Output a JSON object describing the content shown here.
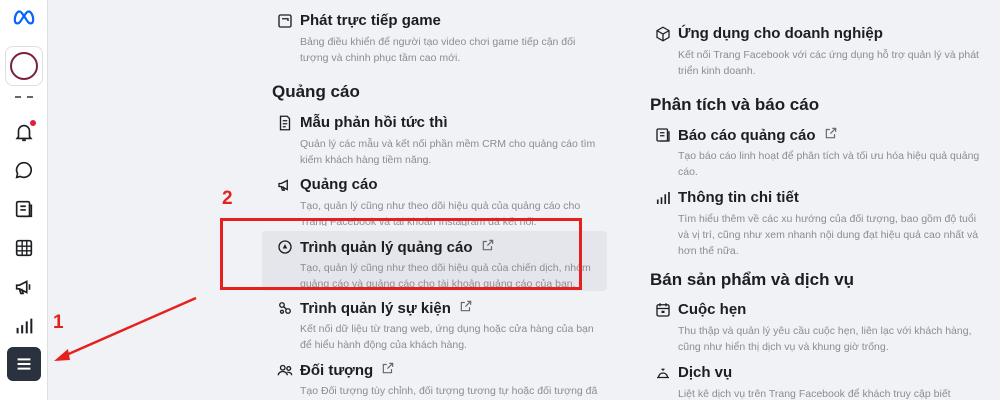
{
  "colors": {
    "accent": "#e5211f",
    "rail_active": "#29323e",
    "meta_blue": "#0866ff"
  },
  "sidebar": {
    "icons": [
      "meta-logo-icon",
      "bell-icon",
      "chat-bubble-icon",
      "pages-icon",
      "table-icon",
      "megaphone-icon",
      "bar-chart-icon",
      "hamburger-menu-icon"
    ]
  },
  "left_column": {
    "items_top": [
      {
        "title": "Phát trực tiếp game",
        "desc": "Bảng điều khiển để người tạo video chơi game tiếp cận đối tượng và chinh phục tầm cao mới."
      }
    ],
    "section_ads": "Quảng cáo",
    "ads_items": [
      {
        "title": "Mẫu phản hồi tức thì",
        "desc": "Quản lý các mẫu và kết nối phần mềm CRM cho quảng cáo tìm kiếm khách hàng tiềm năng."
      },
      {
        "title": "Quảng cáo",
        "desc": "Tạo, quản lý cũng như theo dõi hiệu quả của quảng cáo cho Trang Facebook và tài khoản Instagram đã kết nối."
      },
      {
        "title": "Trình quản lý quảng cáo",
        "desc": "Tạo, quản lý cũng như theo dõi hiệu quả của chiến dịch, nhóm quảng cáo và quảng cáo cho tài khoản quảng cáo của bạn."
      },
      {
        "title": "Trình quản lý sự kiện",
        "desc": "Kết nối dữ liệu từ trang web, ứng dụng hoặc cửa hàng của bạn để hiểu hành động của khách hàng."
      },
      {
        "title": "Đối tượng",
        "desc": "Tạo Đối tượng tùy chỉnh, đối tượng tương tự hoặc đối tượng đã lưu cho chiến dịch quảng cáo."
      }
    ]
  },
  "right_column": {
    "item_top": {
      "title": "Ứng dụng cho doanh nghiệp",
      "desc": "Kết nối Trang Facebook với các ứng dụng hỗ trợ quản lý và phát triển kinh doanh."
    },
    "section_analytics": "Phân tích và báo cáo",
    "analytics_items": [
      {
        "title": "Báo cáo quảng cáo",
        "desc": "Tạo báo cáo linh hoạt để phân tích và tối ưu hóa hiệu quả quảng cáo."
      },
      {
        "title": "Thông tin chi tiết",
        "desc": "Tìm hiểu thêm về các xu hướng của đối tượng, bao gồm độ tuổi và vị trí, cũng như xem nhanh nội dung đạt hiệu quả cao nhất và hơn thế nữa."
      }
    ],
    "section_sell": "Bán sản phẩm và dịch vụ",
    "sell_items": [
      {
        "title": "Cuộc hẹn",
        "desc": "Thu thập và quản lý yêu cầu cuộc hẹn, liên lạc với khách hàng, cũng như hiển thị dịch vụ và khung giờ trống."
      },
      {
        "title": "Dịch vụ",
        "desc": "Liệt kê dịch vụ trên Trang Facebook để khách truy cập biết"
      }
    ]
  },
  "annotations": {
    "step1": "1",
    "step2": "2"
  }
}
